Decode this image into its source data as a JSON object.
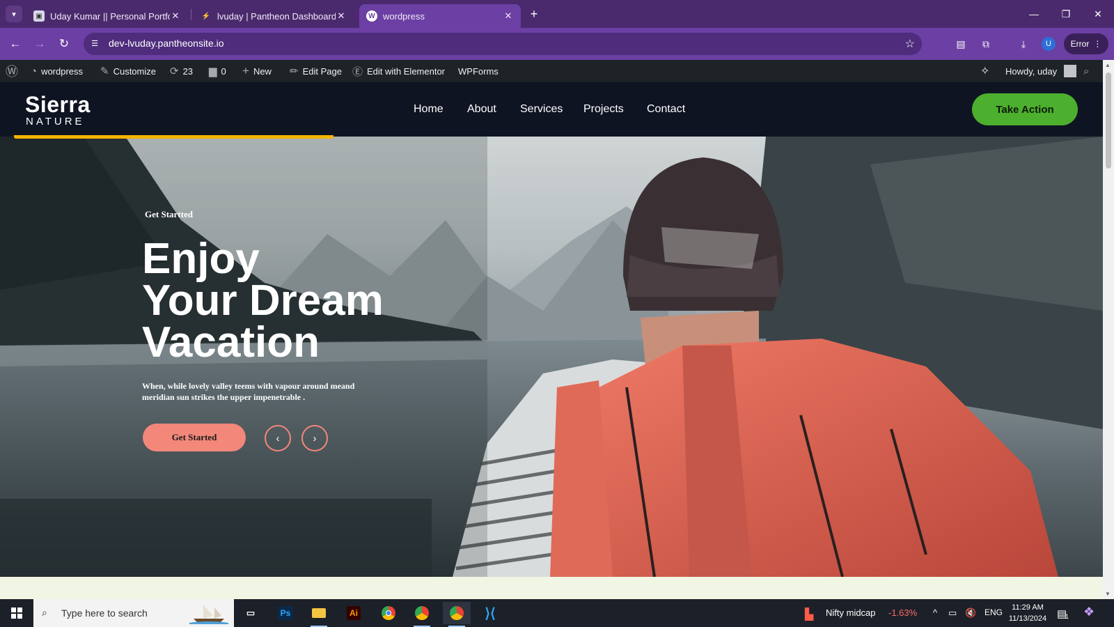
{
  "browser": {
    "tabs": [
      {
        "title": "Uday Kumar || Personal Portfolio",
        "active": false
      },
      {
        "title": "lvuday | Pantheon Dashboard",
        "active": false
      },
      {
        "title": "wordpress",
        "active": true
      }
    ],
    "url": "dev-lvuday.pantheonsite.io",
    "error_label": "Error",
    "profile_initial": "U"
  },
  "admin_bar": {
    "site_name": "wordpress",
    "customize": "Customize",
    "updates_count": "23",
    "comments_count": "0",
    "new_label": "New",
    "edit_page": "Edit Page",
    "elementor": "Edit with Elementor",
    "wpforms": "WPForms",
    "greeting": "Howdy, uday"
  },
  "site": {
    "logo_main": "Sierra",
    "logo_sub": "NATURE",
    "nav": [
      "Home",
      "About",
      "Services",
      "Projects",
      "Contact"
    ],
    "cta": "Take Action",
    "slider_progress": 0.29
  },
  "hero": {
    "eyebrow": "Get Startted",
    "title_lines": [
      "Enjoy",
      "Your Dream",
      "Vacation"
    ],
    "description": "When, while lovely valley teems with vapour around meand meridian sun strikes the upper impenetrable .",
    "button": "Get Started",
    "prev_icon": "chevron-left-icon",
    "next_icon": "chevron-right-icon"
  },
  "taskbar": {
    "search_placeholder": "Type here to search",
    "widget_label": "Nifty midcap",
    "widget_change": "-1.63%",
    "language": "ENG",
    "time": "11:29 AM",
    "date": "11/13/2024",
    "notification_count": "1"
  },
  "colors": {
    "tabstrip": "#4a2a6d",
    "toolbar": "#6b3fa3",
    "header_bg": "#0f1423",
    "cta_green": "#4caf2e",
    "accent_salmon": "#f2877a",
    "progress_yellow": "#f4b400",
    "negative_red": "#ff6b6b"
  }
}
